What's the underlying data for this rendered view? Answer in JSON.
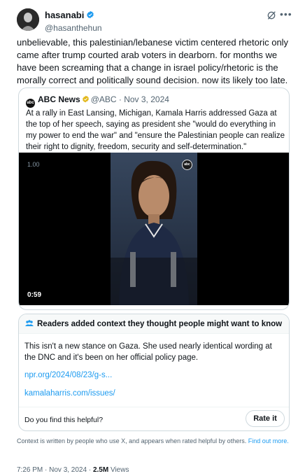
{
  "tweet": {
    "display_name": "hasanabi",
    "handle": "@hasanthehun",
    "text": "unbelievable, this palestinian/lebanese victim centered rhetoric only came after trump courted arab voters in dearborn. for months we have been screaming that a change in israel policy/rhetoric is the morally correct and politically sound decision. now its likely too late.",
    "time": "7:26 PM · Nov 3, 2024 · ",
    "views_count": "2.5M",
    "views_label": " Views"
  },
  "quote": {
    "display_name": "ABC News",
    "handle_date": "@ABC · Nov 3, 2024",
    "avatar_text": "abc",
    "text": "At a rally in East Lansing, Michigan, Kamala Harris addressed Gaza at the top of her speech, saying as president she \"would do everything in my power to end the war\" and \"ensure the Palestinian people can realize their right to dignity, freedom, security and self-determination.\"",
    "video": {
      "speed": "1.00",
      "duration": "0:59",
      "watermark": "abc"
    }
  },
  "community_note": {
    "header": "Readers added context they thought people might want to know",
    "text": "This isn't a new stance on Gaza. She used nearly identical wording at the DNC and it's been on her official policy page.",
    "links": [
      "npr.org/2024/08/23/g-s...",
      "kamalaharris.com/issues/"
    ],
    "helpful_question": "Do you find this helpful?",
    "rate_label": "Rate it"
  },
  "disclaimer": {
    "text": "Context is written by people who use X, and appears when rated helpful by others. ",
    "link": "Find out more."
  },
  "colors": {
    "link": "#1d9bf0",
    "verified_blue": "#1d9bf0",
    "verified_gold": "#e2b719",
    "muted_text": "#536471",
    "border": "#cfd9de"
  },
  "icons": [
    "verified-badge-icon",
    "grok-icon",
    "more-icon",
    "gold-verified-badge-icon",
    "people-icon"
  ]
}
